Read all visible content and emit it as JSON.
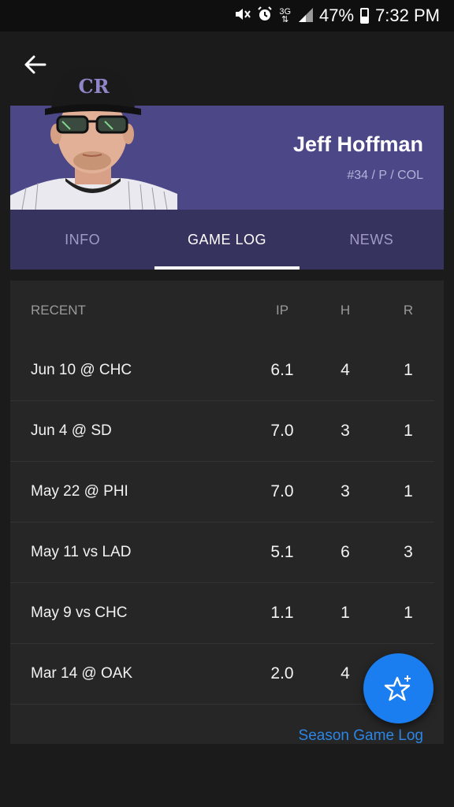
{
  "status_bar": {
    "network": "3G",
    "battery": "47%",
    "time": "7:32 PM"
  },
  "player": {
    "name": "Jeff Hoffman",
    "meta": "#34 / P / COL",
    "cap_logo": "CR"
  },
  "tabs": [
    {
      "label": "INFO",
      "active": false
    },
    {
      "label": "GAME LOG",
      "active": true
    },
    {
      "label": "NEWS",
      "active": false
    }
  ],
  "game_log": {
    "columns": [
      "RECENT",
      "IP",
      "H",
      "R"
    ],
    "rows": [
      {
        "game": "Jun 10 @ CHC",
        "ip": "6.1",
        "h": "4",
        "r": "1"
      },
      {
        "game": "Jun 4 @ SD",
        "ip": "7.0",
        "h": "3",
        "r": "1"
      },
      {
        "game": "May 22 @ PHI",
        "ip": "7.0",
        "h": "3",
        "r": "1"
      },
      {
        "game": "May 11 vs LAD",
        "ip": "5.1",
        "h": "6",
        "r": "3"
      },
      {
        "game": "May 9 vs CHC",
        "ip": "1.1",
        "h": "1",
        "r": "1"
      },
      {
        "game": "Mar 14 @ OAK",
        "ip": "2.0",
        "h": "4",
        "r": ""
      }
    ],
    "season_link": "Season Game Log"
  },
  "icons": {
    "back": "back-arrow-icon",
    "fab": "star-add-icon"
  },
  "colors": {
    "header_bg": "#4c4888",
    "tabs_bg": "#36335f",
    "card_bg": "#262626",
    "link": "#2c86e6",
    "fab": "#1a7df0"
  }
}
